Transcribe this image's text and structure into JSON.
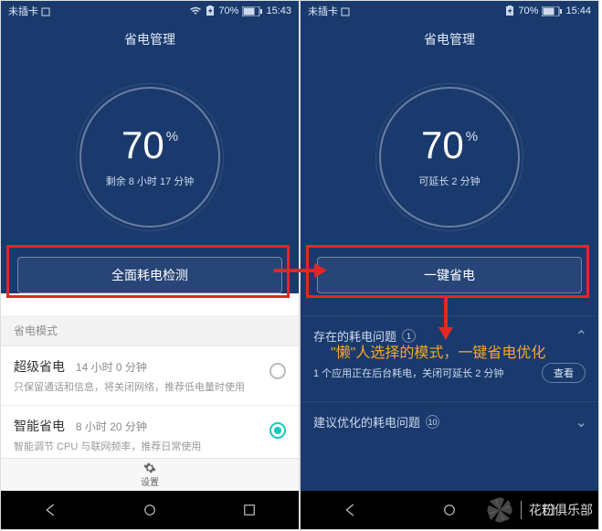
{
  "left": {
    "status": {
      "sim": "未插卡",
      "battery": "70%",
      "time": "15:43"
    },
    "title": "省电管理",
    "percent": "70",
    "percent_sym": "%",
    "remain": "剩余 8 小时 17 分钟",
    "main_button": "全面耗电检测",
    "section_label": "省电模式",
    "modes": [
      {
        "name": "超级省电",
        "duration": "14 小时 0 分钟",
        "desc": "只保留通话和信息，将关闭网络，推荐低电量时使用",
        "selected": false
      },
      {
        "name": "智能省电",
        "duration": "8 小时 20 分钟",
        "desc": "智能调节 CPU 与联网频率，推荐日常使用",
        "selected": true
      }
    ],
    "footer_label": "设置"
  },
  "right": {
    "status": {
      "sim": "未插卡",
      "battery": "70%",
      "time": "15:44"
    },
    "title": "省电管理",
    "percent": "70",
    "percent_sym": "%",
    "remain": "可延长 2 分钟",
    "main_button": "一键省电",
    "issues": {
      "title": "存在的耗电问题",
      "count": "1",
      "line": "1 个应用正在后台耗电，关闭可延长 2 分钟",
      "view": "查看"
    },
    "optimize": {
      "title": "建议优化的耗电问题",
      "count": "10"
    }
  },
  "annotation": "\"懒\"人选择的模式，一键省电优化",
  "watermark": "花粉俱乐部"
}
